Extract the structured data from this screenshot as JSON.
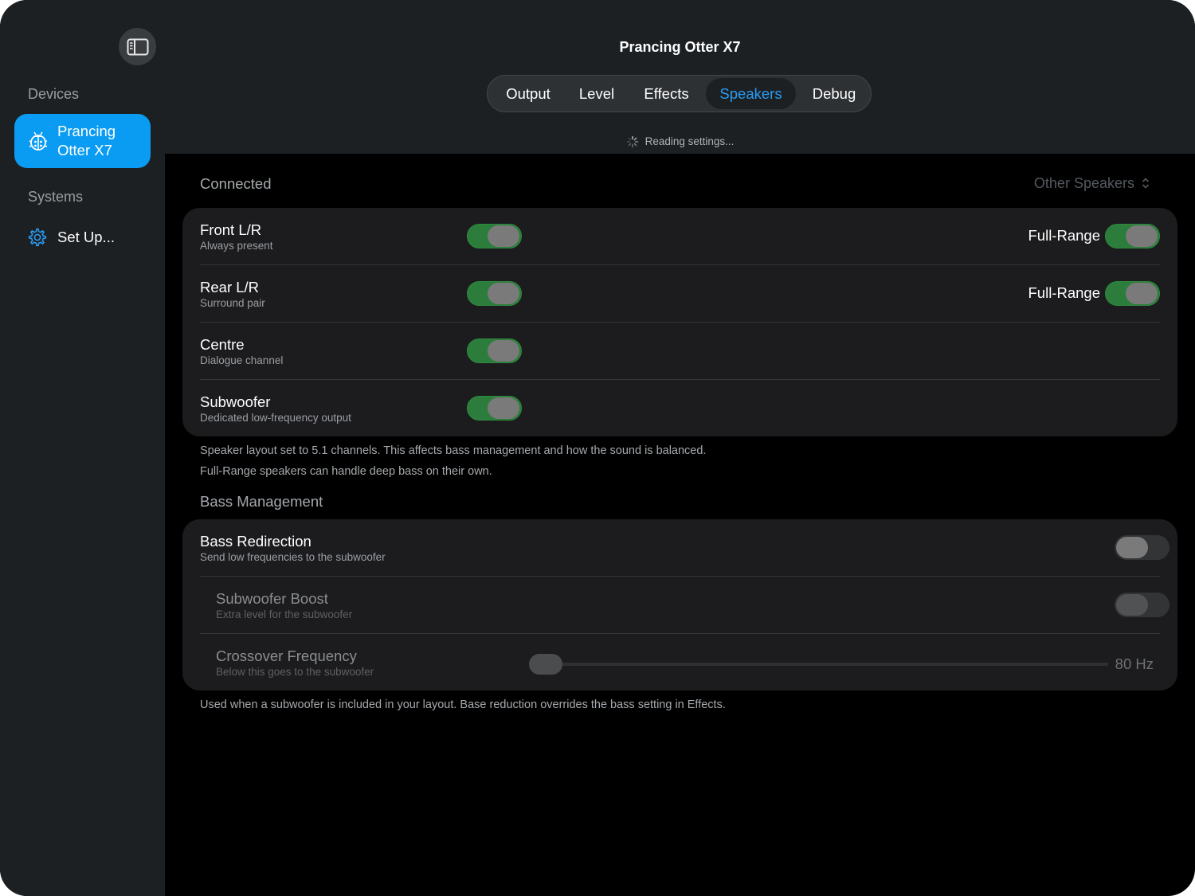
{
  "sidebar": {
    "devices_heading": "Devices",
    "device_name": "Prancing\nOtter X7",
    "systems_heading": "Systems",
    "setup_label": "Set Up..."
  },
  "header": {
    "title": "Prancing Otter X7",
    "tabs": [
      {
        "label": "Output",
        "active": false
      },
      {
        "label": "Level",
        "active": false
      },
      {
        "label": "Effects",
        "active": false
      },
      {
        "label": "Speakers",
        "active": true
      },
      {
        "label": "Debug",
        "active": false
      }
    ],
    "status": "Reading settings..."
  },
  "connected": {
    "title": "Connected",
    "other_speakers": "Other Speakers",
    "speakers": [
      {
        "name": "Front L/R",
        "sub": "Always present",
        "enabled": true,
        "full_range_label": "Full-Range",
        "full_range": true
      },
      {
        "name": "Rear L/R",
        "sub": "Surround pair",
        "enabled": true,
        "full_range_label": "Full-Range",
        "full_range": true
      },
      {
        "name": "Centre",
        "sub": "Dialogue channel",
        "enabled": true
      },
      {
        "name": "Subwoofer",
        "sub": "Dedicated low-frequency output",
        "enabled": true
      }
    ],
    "note1": "Speaker layout set to 5.1 channels. This affects bass management and how the sound is balanced.",
    "note2": "Full-Range speakers can handle deep bass on their own."
  },
  "bass": {
    "title": "Bass Management",
    "redirection": {
      "name": "Bass Redirection",
      "sub": "Send low frequencies to the subwoofer",
      "enabled": false
    },
    "boost": {
      "name": "Subwoofer Boost",
      "sub": "Extra level for the subwoofer",
      "enabled": false
    },
    "crossover": {
      "name": "Crossover Frequency",
      "sub": "Below this goes to the subwoofer",
      "value": "80 Hz"
    },
    "note": "Used when a subwoofer is included in your layout.  Base reduction overrides the bass setting in Effects."
  },
  "colors": {
    "accent": "#0a9cf2",
    "toggle_on": "#2c7d3b",
    "active_tab_text": "#2a9df4"
  }
}
